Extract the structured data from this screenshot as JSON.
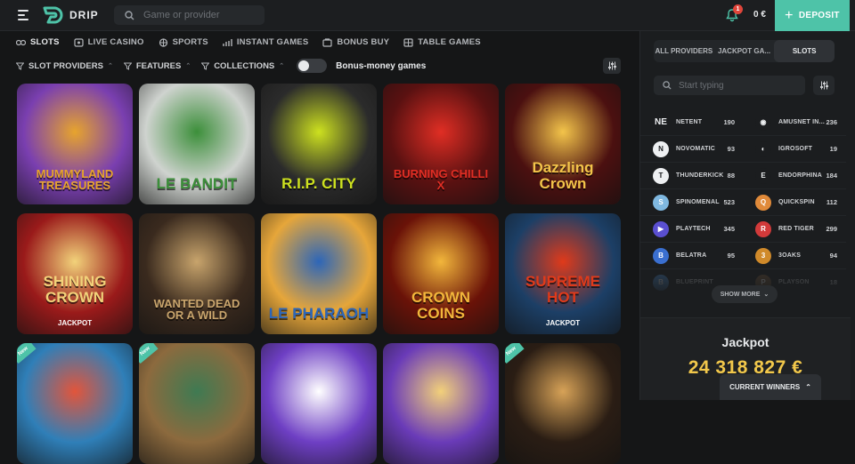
{
  "header": {
    "logo_text": "DRIP",
    "search_placeholder": "Game or provider",
    "notification_count": "1",
    "balance": "0 €",
    "deposit_label": "DEPOSIT"
  },
  "categories": [
    {
      "label": "SLOTS",
      "icon": "slots-icon",
      "active": true
    },
    {
      "label": "LIVE CASINO",
      "icon": "live-casino-icon"
    },
    {
      "label": "SPORTS",
      "icon": "sports-icon"
    },
    {
      "label": "INSTANT GAMES",
      "icon": "instant-games-icon"
    },
    {
      "label": "BONUS BUY",
      "icon": "bonus-buy-icon"
    },
    {
      "label": "TABLE GAMES",
      "icon": "table-games-icon"
    }
  ],
  "filters": {
    "slot_providers": "SLOT PROVIDERS",
    "features": "FEATURES",
    "collections": "COLLECTIONS",
    "bonus_toggle_label": "Bonus-money games"
  },
  "games": [
    {
      "title": "MUMMYLAND TREASURES",
      "bg": "#7a3fb0",
      "accent": "#e7a42d"
    },
    {
      "title": "LE BANDIT",
      "bg": "#cfd3cf",
      "accent": "#3c8f3a"
    },
    {
      "title": "R.I.P. CITY",
      "bg": "#2b2b2b",
      "accent": "#cde11f"
    },
    {
      "title": "BURNING CHILLI X",
      "bg": "#5a1111",
      "accent": "#e02e24"
    },
    {
      "title": "Dazzling Crown",
      "bg": "#4b1010",
      "accent": "#f3c44a"
    },
    {
      "title": "SHINING CROWN",
      "bg": "#9a1a1a",
      "accent": "#f2d27a",
      "label": "JACKPOT"
    },
    {
      "title": "WANTED DEAD OR A WILD",
      "bg": "#3a2a1e",
      "accent": "#c8a46c"
    },
    {
      "title": "LE PHARAOH",
      "bg": "#e6a63a",
      "accent": "#2d66b8"
    },
    {
      "title": "CROWN COINS",
      "bg": "#6a1208",
      "accent": "#f2b63b"
    },
    {
      "title": "SUPREME HOT",
      "bg": "#1c3f66",
      "accent": "#e03a1a",
      "label": "JACKPOT"
    },
    {
      "title": "",
      "bg": "#2f7fb8",
      "accent": "#e2553b",
      "badge": "New"
    },
    {
      "title": "",
      "bg": "#8c6a3e",
      "accent": "#3f7a52",
      "badge": "New"
    },
    {
      "title": "",
      "bg": "#6e3fc4",
      "accent": "#ffffff"
    },
    {
      "title": "",
      "bg": "#6a3bb8",
      "accent": "#f2d07a"
    },
    {
      "title": "",
      "bg": "#2a1d14",
      "accent": "#d7a257",
      "badge": "New"
    }
  ],
  "providers_panel": {
    "tabs": [
      "ALL PROVIDERS",
      "JACKPOT GA...",
      "SLOTS"
    ],
    "active_tab": 2,
    "search_placeholder": "Start typing",
    "providers": [
      {
        "name": "NETENT",
        "count": "190",
        "logo": "NE"
      },
      {
        "name": "AMUSNET IN...",
        "count": "236",
        "logo": "◉"
      },
      {
        "name": "NOVOMATIC",
        "count": "93",
        "logo": "N"
      },
      {
        "name": "IGROSOFT",
        "count": "19",
        "logo": "◐"
      },
      {
        "name": "THUNDERKICK",
        "count": "88",
        "logo": "T"
      },
      {
        "name": "ENDORPHINA",
        "count": "184",
        "logo": "E"
      },
      {
        "name": "SPINOMENAL",
        "count": "523",
        "logo": "S"
      },
      {
        "name": "QUICKSPIN",
        "count": "112",
        "logo": "Q"
      },
      {
        "name": "PLAYTECH",
        "count": "345",
        "logo": "▶"
      },
      {
        "name": "RED TIGER",
        "count": "299",
        "logo": "R"
      },
      {
        "name": "BELATRA",
        "count": "95",
        "logo": "B"
      },
      {
        "name": "3OAKS",
        "count": "94",
        "logo": "3"
      },
      {
        "name": "BLUEPRINT",
        "count": "",
        "logo": "B"
      },
      {
        "name": "PLAYSON",
        "count": "18",
        "logo": "P"
      }
    ],
    "show_more": "SHOW MORE",
    "jackpot_title": "Jackpot",
    "jackpot_amount": "24 318 827 €",
    "current_winners": "CURRENT WINNERS"
  }
}
